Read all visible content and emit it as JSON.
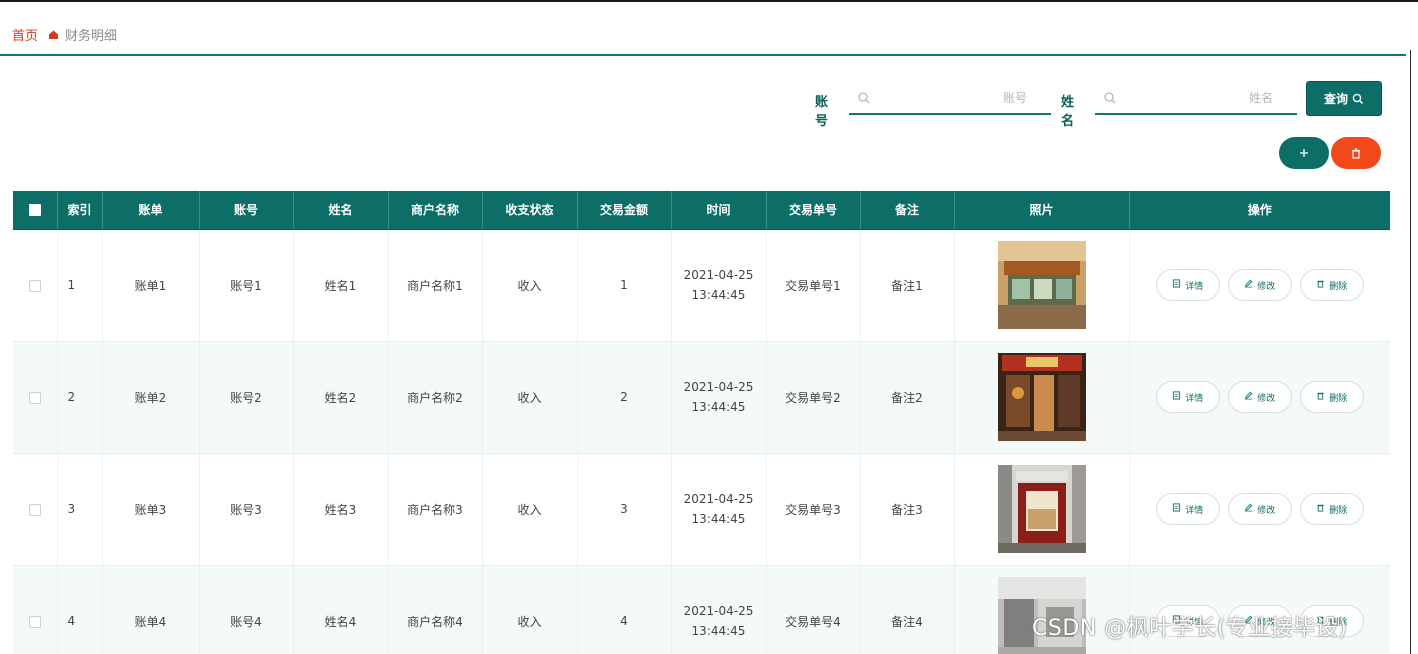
{
  "breadcrumb": {
    "home": "首页",
    "current": "财务明细"
  },
  "search": {
    "account_label": "账号",
    "account_placeholder": "账号",
    "name_label": "姓名",
    "name_placeholder": "姓名",
    "query_button": "查询"
  },
  "colors": {
    "primary": "#0d6e68",
    "danger": "#f2491b",
    "breadcrumb_home": "#d9381e"
  },
  "table": {
    "headers": [
      "索引",
      "账单",
      "账号",
      "姓名",
      "商户名称",
      "收支状态",
      "交易金额",
      "时间",
      "交易单号",
      "备注",
      "照片",
      "操作"
    ],
    "rows": [
      {
        "index": "1",
        "bill": "账单1",
        "account": "账号1",
        "name": "姓名1",
        "merchant": "商户名称1",
        "status": "收入",
        "amount": "1",
        "date": "2021-04-25",
        "time": "13:44:45",
        "trade_no": "交易单号1",
        "remark": "备注1"
      },
      {
        "index": "2",
        "bill": "账单2",
        "account": "账号2",
        "name": "姓名2",
        "merchant": "商户名称2",
        "status": "收入",
        "amount": "2",
        "date": "2021-04-25",
        "time": "13:44:45",
        "trade_no": "交易单号2",
        "remark": "备注2"
      },
      {
        "index": "3",
        "bill": "账单3",
        "account": "账号3",
        "name": "姓名3",
        "merchant": "商户名称3",
        "status": "收入",
        "amount": "3",
        "date": "2021-04-25",
        "time": "13:44:45",
        "trade_no": "交易单号3",
        "remark": "备注3"
      },
      {
        "index": "4",
        "bill": "账单4",
        "account": "账号4",
        "name": "姓名4",
        "merchant": "商户名称4",
        "status": "收入",
        "amount": "4",
        "date": "2021-04-25",
        "time": "13:44:45",
        "trade_no": "交易单号4",
        "remark": "备注4"
      }
    ],
    "actions": {
      "detail": "详情",
      "edit": "修改",
      "delete": "删除"
    }
  },
  "watermark": "CSDN @枫叶学长(专业接毕设)"
}
